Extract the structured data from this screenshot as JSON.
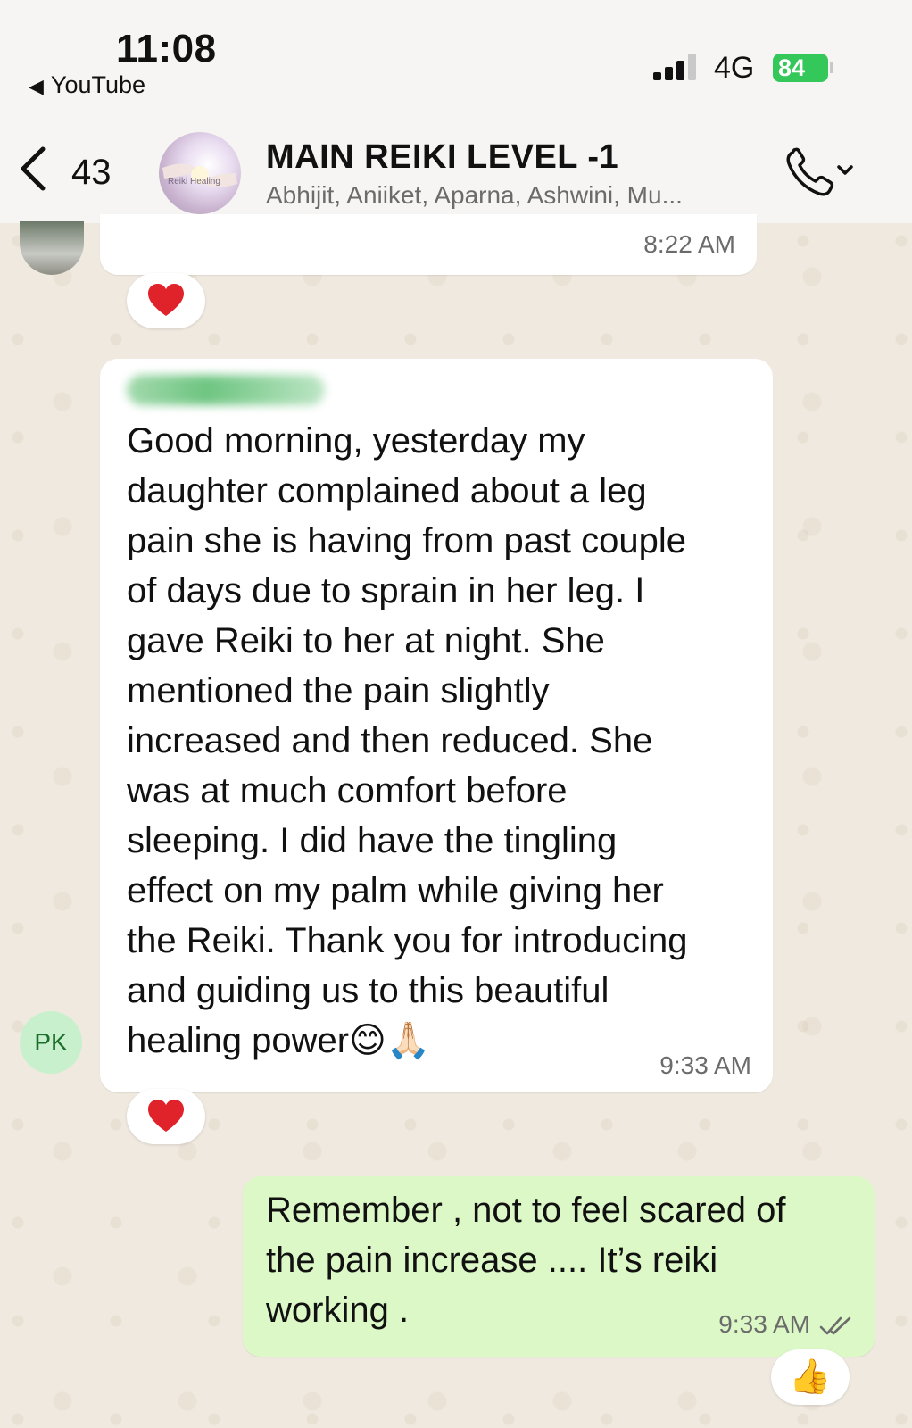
{
  "status_bar": {
    "time": "11:08",
    "back_app": "YouTube",
    "network": "4G",
    "battery": "84"
  },
  "header": {
    "back_count": "43",
    "group_name": "MAIN REIKI LEVEL -1",
    "members": "Abhijit, Aniiket, Aparna, Ashwini, Mu...",
    "avatar_label": "Reiki Healing"
  },
  "messages": [
    {
      "direction": "incoming",
      "time": "8:22 AM",
      "reaction": "heart-icon"
    },
    {
      "direction": "incoming",
      "sender_initials": "PK",
      "text": "Good morning, yesterday my\ndaughter complained about a leg\npain she is having from past couple\nof days due to sprain in her leg. I\ngave Reiki to her at night. She\nmentioned the pain slightly\nincreased and then reduced. She\nwas at much comfort before\nsleeping. I did have the tingling\neffect on my palm while giving her\nthe Reiki. Thank you for introducing\nand guiding us to this beautiful\nhealing power😊🙏🏻",
      "time": "9:33 AM",
      "reaction": "heart-icon"
    },
    {
      "direction": "outgoing",
      "text": "Remember , not to feel scared of\nthe pain increase .... It’s reiki\nworking .",
      "time": "9:33 AM",
      "reaction": "👍"
    }
  ],
  "colors": {
    "incoming_bubble": "#ffffff",
    "outgoing_bubble": "#dcf8c6",
    "battery": "#34c759",
    "heart": "#e0222a"
  }
}
